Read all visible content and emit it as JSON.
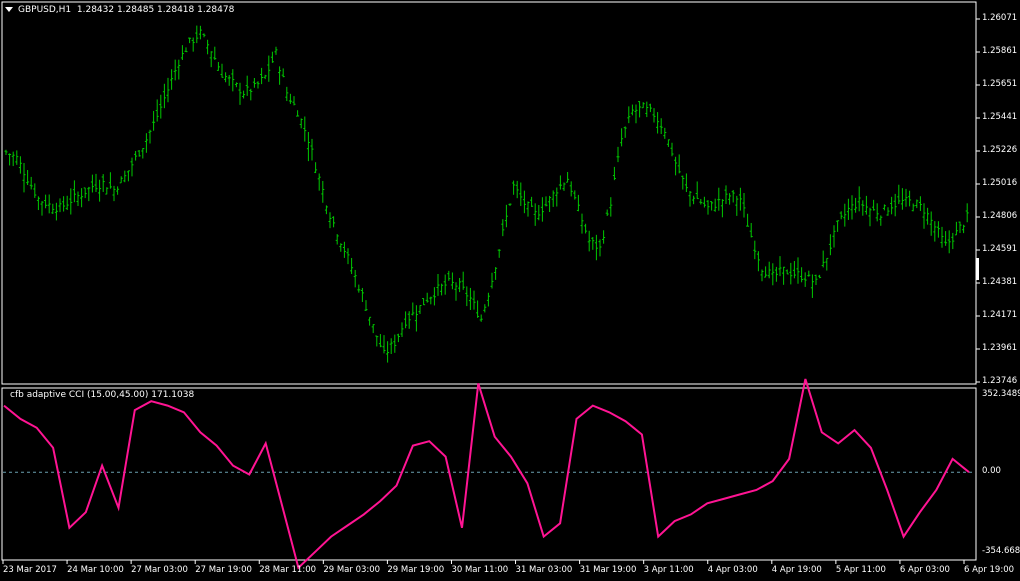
{
  "main_panel": {
    "title": "GBPUSD,H1  1.28432 1.28485 1.28418 1.28478",
    "symbol": "GBPUSD,H1",
    "quote": {
      "open": "1.28432",
      "high": "1.28485",
      "low": "1.28418",
      "close": "1.28478"
    },
    "bar_color": "#00c800",
    "price_scale": [
      "1.26071",
      "1.25861",
      "1.25651",
      "1.25441",
      "1.25226",
      "1.25016",
      "1.24806",
      "1.24591",
      "1.24381",
      "1.24171",
      "1.23961",
      "1.23746"
    ]
  },
  "indicator_panel": {
    "title": "cfb adaptive CCI (15.00,45.00) 171.1038",
    "line_color": "#ff1493",
    "zero_line_color": "#6aa0b0",
    "scale": [
      "352.3489",
      "0.00",
      "-354.6681"
    ]
  },
  "time_axis": [
    "23 Mar 2017",
    "24 Mar 10:00",
    "27 Mar 03:00",
    "27 Mar 19:00",
    "28 Mar 11:00",
    "29 Mar 03:00",
    "29 Mar 19:00",
    "30 Mar 11:00",
    "31 Mar 03:00",
    "31 Mar 19:00",
    "3 Apr 11:00",
    "4 Apr 03:00",
    "4 Apr 19:00",
    "5 Apr 11:00",
    "6 Apr 03:00",
    "6 Apr 19:00"
  ],
  "chart_data": {
    "type": "line",
    "title": "GBPUSD,H1",
    "price_path": [
      1.2522,
      1.2518,
      1.2505,
      1.2492,
      1.2488,
      1.2486,
      1.2491,
      1.2495,
      1.25,
      1.2502,
      1.2498,
      1.2506,
      1.2518,
      1.253,
      1.2545,
      1.2562,
      1.258,
      1.2592,
      1.2598,
      1.2587,
      1.2572,
      1.2566,
      1.256,
      1.2563,
      1.257,
      1.2585,
      1.256,
      1.2548,
      1.253,
      1.2505,
      1.2482,
      1.2465,
      1.2448,
      1.243,
      1.241,
      1.2392,
      1.24,
      1.2414,
      1.242,
      1.2428,
      1.2434,
      1.2438,
      1.2436,
      1.2428,
      1.2415,
      1.244,
      1.247,
      1.25,
      1.2489,
      1.2482,
      1.2488,
      1.2498,
      1.2505,
      1.2485,
      1.2465,
      1.246,
      1.249,
      1.253,
      1.2548,
      1.255,
      1.2546,
      1.2536,
      1.2515,
      1.2498,
      1.2492,
      1.2486,
      1.249,
      1.2494,
      1.2492,
      1.2468,
      1.2448,
      1.2442,
      1.2446,
      1.2444,
      1.2442,
      1.2438,
      1.2455,
      1.2475,
      1.2485,
      1.249,
      1.2485,
      1.2483,
      1.2488,
      1.249,
      1.249,
      1.2485,
      1.2474,
      1.2462,
      1.247,
      1.248
    ],
    "indicator_path": [
      300,
      240,
      200,
      110,
      -250,
      -180,
      30,
      -160,
      280,
      320,
      300,
      270,
      180,
      120,
      30,
      -10,
      130,
      -150,
      -430,
      -360,
      -290,
      -240,
      -190,
      -130,
      -60,
      120,
      140,
      70,
      -250,
      400,
      160,
      70,
      -50,
      -290,
      -230,
      240,
      300,
      270,
      230,
      170,
      -290,
      -220,
      -190,
      -140,
      -120,
      -100,
      -80,
      -40,
      60,
      420,
      180,
      130,
      190,
      110,
      -80,
      -290,
      -180,
      -80,
      60,
      0
    ]
  }
}
